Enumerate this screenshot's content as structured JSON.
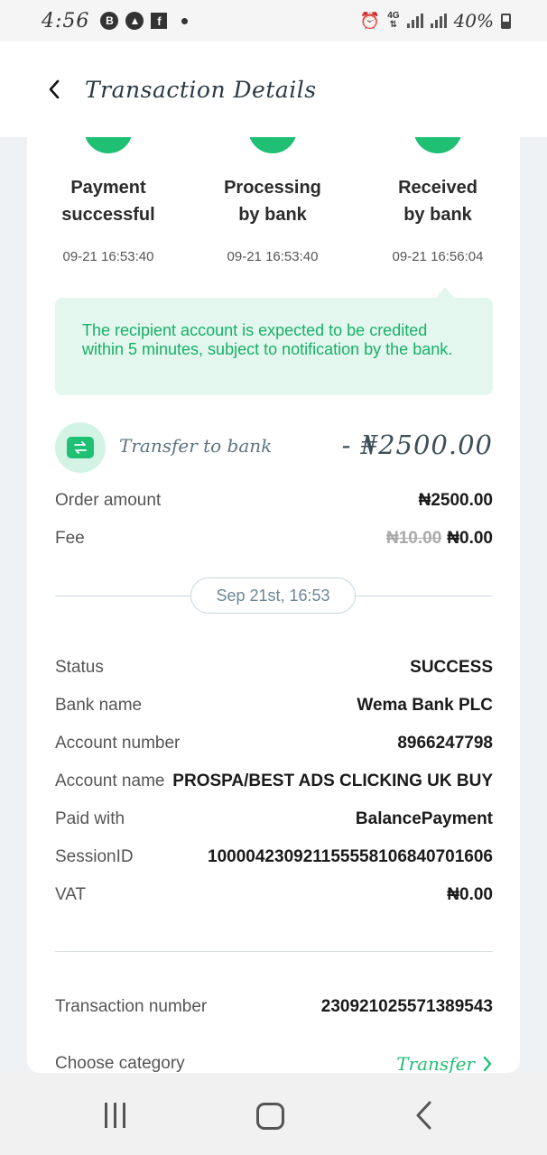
{
  "status_bar": {
    "time": "4:56",
    "network": "4G",
    "battery": "40%"
  },
  "header": {
    "title": "Transaction Details"
  },
  "steps": [
    {
      "line1": "Payment",
      "line2": "successful",
      "time": "09-21 16:53:40"
    },
    {
      "line1": "Processing",
      "line2": "by bank",
      "time": "09-21 16:53:40"
    },
    {
      "line1": "Received",
      "line2": "by bank",
      "time": "09-21 16:56:04"
    }
  ],
  "note": "The recipient account is expected to be credited within 5 minutes, subject to notification by the bank.",
  "transfer": {
    "label": "Transfer to bank",
    "amount": "- ₦2500.00"
  },
  "summary": {
    "order_amount_label": "Order amount",
    "order_amount_value": "₦2500.00",
    "fee_label": "Fee",
    "fee_original": "₦10.00",
    "fee_value": "₦0.00"
  },
  "date_pill": "Sep 21st, 16:53",
  "details": [
    {
      "label": "Status",
      "value": "SUCCESS"
    },
    {
      "label": "Bank name",
      "value": "Wema Bank PLC"
    },
    {
      "label": "Account number",
      "value": "8966247798"
    },
    {
      "label": "Account name",
      "value": "PROSPA/BEST ADS CLICKING UK BUY"
    },
    {
      "label": "Paid with",
      "value": "BalancePayment"
    },
    {
      "label": "SessionID",
      "value": "100004230921155558106840701606"
    },
    {
      "label": "VAT",
      "value": "₦0.00"
    }
  ],
  "transaction": {
    "number_label": "Transaction number",
    "number_value": "230921025571389543",
    "category_label": "Choose category",
    "category_value": "Transfer"
  },
  "colors": {
    "accent_green": "#1fbf74",
    "note_bg": "#e3f7ee",
    "page_bg": "#eef2f5"
  }
}
